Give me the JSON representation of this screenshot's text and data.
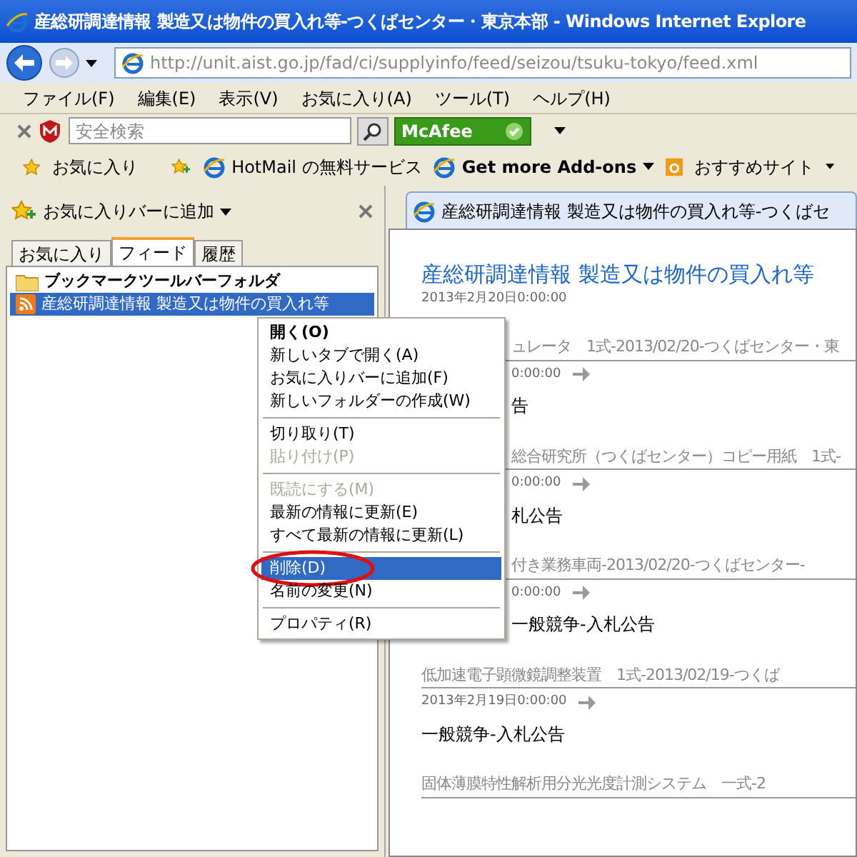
{
  "window": {
    "title": "産総研調達情報 製造又は物件の買入れ等-つくばセンター・東京本部 - Windows Internet Explore"
  },
  "address": {
    "value": "http://unit.aist.go.jp/fad/ci/supplyinfo/feed/seizou/tsuku-tokyo/feed.xml"
  },
  "menu_bar": [
    "ファイル(F)",
    "編集(E)",
    "表示(V)",
    "お気に入り(A)",
    "ツール(T)",
    "ヘルプ(H)"
  ],
  "search": {
    "placeholder": "安全検索",
    "badge": "McAfee"
  },
  "favorites_bar": {
    "favorites": "お気に入り",
    "links": [
      {
        "label": "HotMail の無料サービス",
        "bold": false,
        "dropdown": false
      },
      {
        "label": "Get more Add-ons",
        "bold": true,
        "dropdown": true
      }
    ],
    "recommended": "おすすめサイト"
  },
  "pane": {
    "add_button": "お気に入りバーに追加",
    "tabs": [
      {
        "label": "お気に入り",
        "selected": false
      },
      {
        "label": "フィード",
        "selected": true
      },
      {
        "label": "履歴",
        "selected": false
      }
    ],
    "tree": [
      {
        "kind": "folder",
        "label": "ブックマークツールバーフォルダ",
        "selected": false
      },
      {
        "kind": "feed",
        "label": "産総研調達情報 製造又は物件の買入れ等",
        "selected": true
      }
    ]
  },
  "context_menu": [
    {
      "kind": "item",
      "label": "開く(O)",
      "bold": true,
      "disabled": false,
      "selected": false
    },
    {
      "kind": "item",
      "label": "新しいタブで開く(A)",
      "bold": false,
      "disabled": false,
      "selected": false
    },
    {
      "kind": "item",
      "label": "お気に入りバーに追加(F)",
      "bold": false,
      "disabled": false,
      "selected": false
    },
    {
      "kind": "item",
      "label": "新しいフォルダーの作成(W)",
      "bold": false,
      "disabled": false,
      "selected": false
    },
    {
      "kind": "separator"
    },
    {
      "kind": "item",
      "label": "切り取り(T)",
      "bold": false,
      "disabled": false,
      "selected": false
    },
    {
      "kind": "item",
      "label": "貼り付け(P)",
      "bold": false,
      "disabled": true,
      "selected": false
    },
    {
      "kind": "separator"
    },
    {
      "kind": "item",
      "label": "既読にする(M)",
      "bold": false,
      "disabled": true,
      "selected": false
    },
    {
      "kind": "item",
      "label": "最新の情報に更新(E)",
      "bold": false,
      "disabled": false,
      "selected": false
    },
    {
      "kind": "item",
      "label": "すべて最新の情報に更新(L)",
      "bold": false,
      "disabled": false,
      "selected": false
    },
    {
      "kind": "separator"
    },
    {
      "kind": "item",
      "label": "削除(D)",
      "bold": false,
      "disabled": false,
      "selected": true
    },
    {
      "kind": "item",
      "label": "名前の変更(N)",
      "bold": false,
      "disabled": false,
      "selected": false
    },
    {
      "kind": "separator"
    },
    {
      "kind": "item",
      "label": "プロパティ(R)",
      "bold": false,
      "disabled": false,
      "selected": false
    }
  ],
  "page_tab": {
    "title": "産総研調達情報 製造又は物件の買入れ等-つくばセ"
  },
  "feed": {
    "title": "産総研調達情報 製造又は物件の買入れ等",
    "date": "2013年2月20日0:00:00",
    "entries": [
      {
        "title": "ュレータ　1式-2013/02/20-つくばセンター・東",
        "date": "0:00:00",
        "category": "告",
        "covered": true
      },
      {
        "title": "総合研究所（つくばセンター）コピー用紙　1式-",
        "date": "0:00:00",
        "category": "札公告",
        "covered": true
      },
      {
        "title": "付き業務車両-2013/02/20-つくばセンター-",
        "date": "0:00:00",
        "category": "一般競争-入札公告",
        "covered": true
      },
      {
        "title": "低加速電子顕微鏡調整装置　1式-2013/02/19-つくば",
        "date": "2013年2月19日0:00:00",
        "category": "一般競争-入札公告",
        "covered": false
      },
      {
        "title": "固体薄膜特性解析用分光光度計測システム　一式-2",
        "covered": false
      }
    ]
  }
}
